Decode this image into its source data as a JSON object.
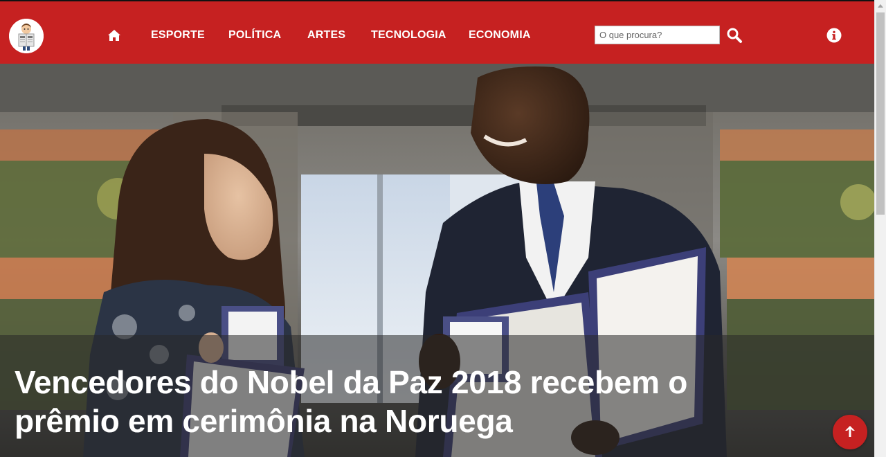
{
  "colors": {
    "brand": "#c62121",
    "nav_text": "#ffffff",
    "caption_overlay": "rgba(40,40,40,0.55)"
  },
  "header": {
    "logo_icon": "newspaper-reader-logo",
    "home_icon": "home-icon",
    "nav": [
      {
        "label": "ESPORTE"
      },
      {
        "label": "POLÍTICA"
      },
      {
        "label": "ARTES"
      },
      {
        "label": "TECNOLOGIA"
      },
      {
        "label": "ECONOMIA"
      }
    ],
    "search": {
      "placeholder": "O que procura?",
      "value": "",
      "icon": "search-icon"
    },
    "info_icon": "info-icon"
  },
  "hero": {
    "headline": "Vencedores do Nobel da Paz 2018 recebem o prêmio em cerimônia na Noruega"
  },
  "back_to_top_icon": "arrow-up-icon"
}
